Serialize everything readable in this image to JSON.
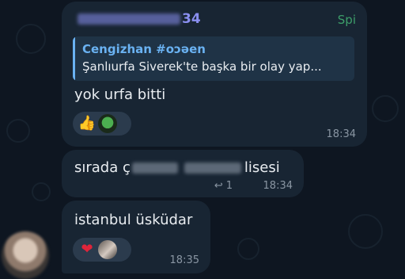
{
  "messages": {
    "first": {
      "sender_suffix": "34",
      "role_badge": "Spi",
      "reply_to": {
        "author": "Cengizhan #oɔəen",
        "preview": "Şanlıurfa Siverek'te başka bir olay yap..."
      },
      "text": "yok urfa bitti",
      "time": "18:34",
      "reactions": [
        "thumbs-up",
        "frog-avatar"
      ]
    },
    "second": {
      "text_prefix": "sırada ç",
      "text_suffix": "lisesi",
      "reply_count": "1",
      "time": "18:34"
    },
    "third": {
      "text": "istanbul üsküdar",
      "time": "18:35",
      "reactions": [
        "red-heart",
        "user-avatar"
      ]
    }
  },
  "colors": {
    "background": "#0e1621",
    "bubble": "#182533",
    "sender_name": "#8a8ff0",
    "reply_author": "#6ab2f2",
    "badge": "#3d9e6a"
  },
  "icons": [
    "reply-arrow-icon",
    "thumbs-up-icon",
    "red-heart-icon"
  ]
}
